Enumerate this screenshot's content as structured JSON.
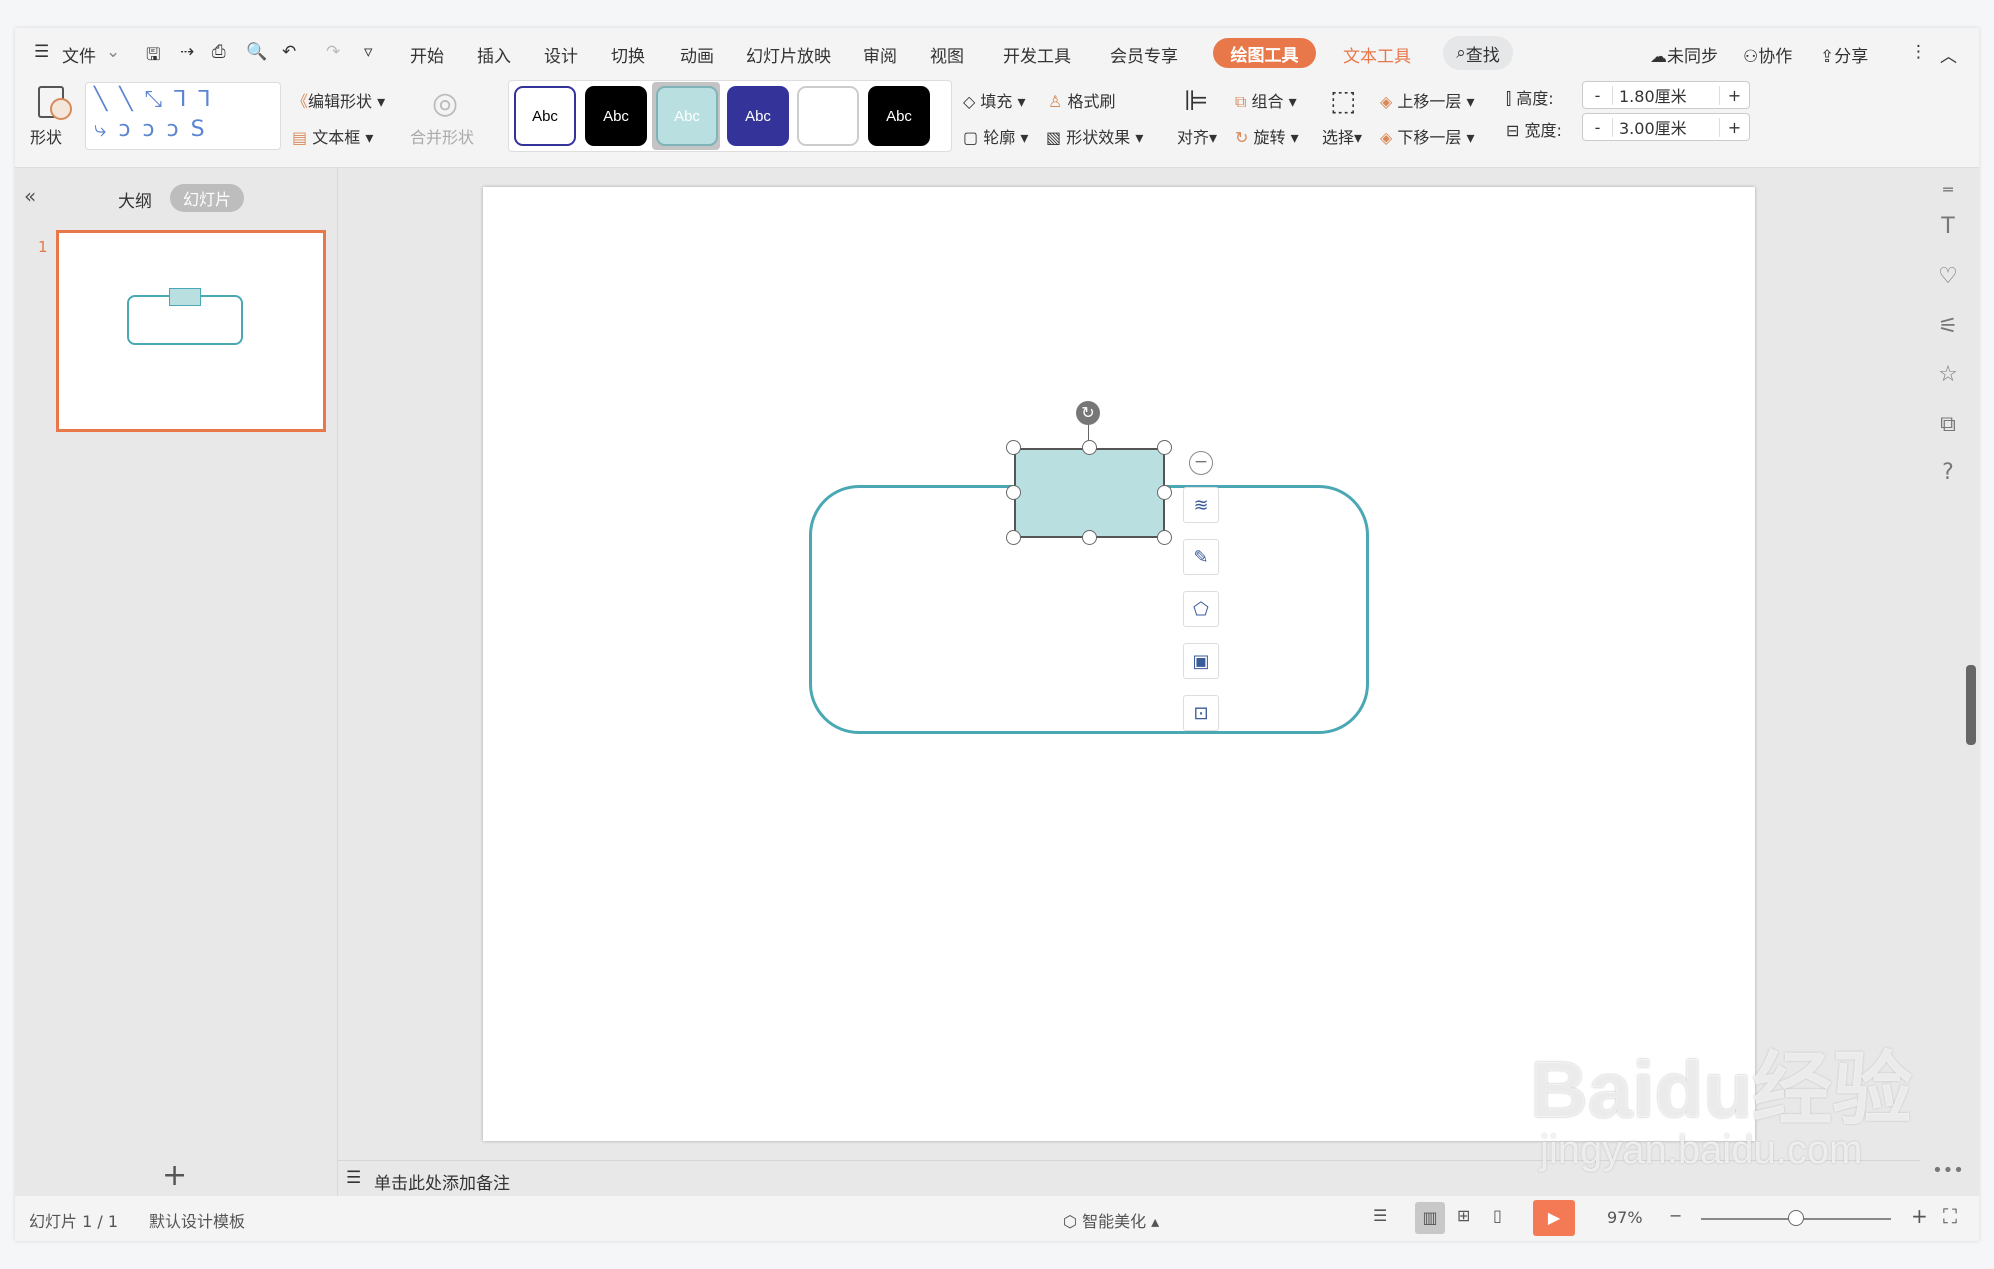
{
  "menu": {
    "file": "文件",
    "tabs": [
      "开始",
      "插入",
      "设计",
      "切换",
      "动画",
      "幻灯片放映",
      "审阅",
      "视图",
      "开发工具",
      "会员专享"
    ],
    "drawing_tools": "绘图工具",
    "text_tools": "文本工具",
    "search": "查找",
    "unsynced": "未同步",
    "collab": "协作",
    "share": "分享"
  },
  "ribbon": {
    "shape": "形状",
    "edit_shape": "编辑形状",
    "textbox": "文本框",
    "merge_shape": "合并形状",
    "styles": [
      "Abc",
      "Abc",
      "Abc",
      "Abc",
      "",
      "Abc"
    ],
    "fill": "填充",
    "format_painter": "格式刷",
    "outline": "轮廓",
    "shape_effect": "形状效果",
    "align": "对齐",
    "group": "组合",
    "rotate": "旋转",
    "select": "选择",
    "bring_forward": "上移一层",
    "send_backward": "下移一层",
    "height_label": "高度:",
    "height_value": "1.80厘米",
    "width_label": "宽度:",
    "width_value": "3.00厘米",
    "minus": "-",
    "plus": "+"
  },
  "left_panel": {
    "collapse": "«",
    "tab_outline": "大纲",
    "tab_slides": "幻灯片",
    "slide_number": "1",
    "add": "+"
  },
  "notes": {
    "placeholder": "单击此处添加备注"
  },
  "status": {
    "slide_count": "幻灯片 1 / 1",
    "template": "默认设计模板",
    "beautify": "智能美化",
    "zoom": "97%",
    "zoom_fraction": 0.5
  },
  "colors": {
    "accent": "#e8784a",
    "shape_fill": "#b9dfe1",
    "shape_stroke": "#4aa8b4",
    "thumb_border": "#e8784a"
  },
  "watermark": "Baidu经验 jingyan.baidu.com"
}
